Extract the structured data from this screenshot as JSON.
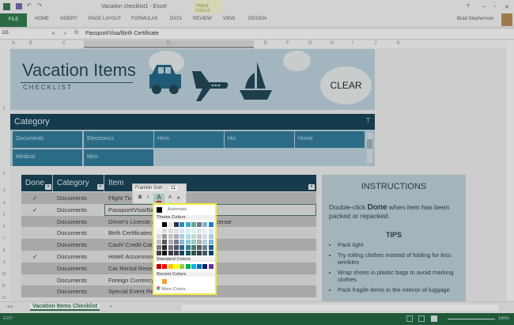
{
  "window": {
    "title": "Vacation checklist1 - Excel",
    "contextual_group": "TABLE TOOLS",
    "user": "Brad Stephenson",
    "help": "?"
  },
  "ribbon": {
    "tabs": [
      "FILE",
      "HOME",
      "INSERT",
      "PAGE LAYOUT",
      "FORMULAS",
      "DATA",
      "REVIEW",
      "VIEW",
      "DESIGN"
    ]
  },
  "formula_bar": {
    "name_box": "D5",
    "cancel": "✕",
    "enter": "✓",
    "fx": "fx",
    "content": "Passport/Visa/Birth Certificate"
  },
  "columns": [
    "A",
    "B",
    "C",
    "D",
    "E",
    "F",
    "G",
    "H",
    "I",
    "J",
    "K"
  ],
  "rows": [
    "1",
    "2",
    "3",
    "4",
    "5",
    "6",
    "7",
    "8",
    "9",
    "10",
    "11",
    "12"
  ],
  "banner": {
    "title": "Vacation Items",
    "subtitle": "CHECKLIST",
    "clear_label": "CLEAR"
  },
  "slicer": {
    "title": "Category",
    "items": [
      "Documents",
      "Electronics",
      "Hers",
      "His",
      "Home",
      "Medical",
      "Misc"
    ]
  },
  "table": {
    "headers": [
      "Done",
      "Category",
      "Item"
    ],
    "rows": [
      {
        "done": "✓",
        "category": "Documents",
        "item": "Flight Tickets"
      },
      {
        "done": "✓",
        "category": "Documents",
        "item": "Passport/Visa/Birth Certificate"
      },
      {
        "done": "",
        "category": "Documents",
        "item": "Driver's License / International Driver's License"
      },
      {
        "done": "",
        "category": "Documents",
        "item": "Birth Certificates"
      },
      {
        "done": "",
        "category": "Documents",
        "item": "Cash/ Credit Cards/ Traveler's Checks"
      },
      {
        "done": "✓",
        "category": "Documents",
        "item": "Hotel/ Accommodations"
      },
      {
        "done": "",
        "category": "Documents",
        "item": "Car Rental Reservation"
      },
      {
        "done": "",
        "category": "Documents",
        "item": "Foreign Currency"
      },
      {
        "done": "",
        "category": "Documents",
        "item": "Special Event Reservations"
      }
    ]
  },
  "instructions": {
    "title": "INSTRUCTIONS",
    "pre": "Double-click ",
    "bold": "Done",
    "post": " when item has been packed or repacked.",
    "tips_title": "TIPS",
    "tips": [
      "Pack light",
      "Try rolling clothes instead of folding for less wrinkles",
      "Wrap shoes in plastic bags to avoid marking clothes",
      "Pack fragile items in the interior of luggage"
    ]
  },
  "mini_toolbar": {
    "font": "Franklin Gotl",
    "size": "11",
    "bold": "B",
    "italic": "I",
    "font_color": "A",
    "grow": "A",
    "shrink": "A"
  },
  "color_picker": {
    "automatic": "Automatic",
    "theme_label": "Theme Colors",
    "standard_label": "Standard Colors",
    "recent_label": "Recent Colors",
    "more": "More Colors...",
    "theme_base": [
      "#ffffff",
      "#000000",
      "#e7e6e6",
      "#2e2f4a",
      "#2e8ab8",
      "#3aa8c0",
      "#5aa898",
      "#6e7f80",
      "#86acc9",
      "#1f7fc0"
    ],
    "standard": [
      "#c00000",
      "#ff0000",
      "#ffc000",
      "#ffff00",
      "#92d050",
      "#00b050",
      "#00b0f0",
      "#0070c0",
      "#002060",
      "#7030a0"
    ],
    "recent": [
      "#f0a030"
    ]
  },
  "sheet_tabs": {
    "active": "Vacation Items Checklist",
    "add": "+"
  },
  "status": {
    "mode": "EDIT",
    "zoom": "100%"
  }
}
